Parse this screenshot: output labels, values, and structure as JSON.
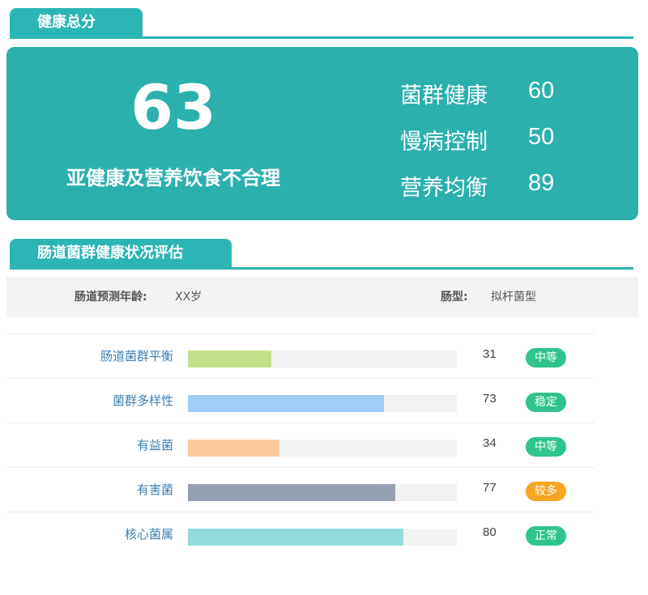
{
  "header1": {
    "title": "健康总分"
  },
  "score": {
    "total": "63",
    "verdict": "亚健康及营养饮食不合理",
    "subs": [
      {
        "label": "菌群健康",
        "value": "60"
      },
      {
        "label": "慢病控制",
        "value": "50"
      },
      {
        "label": "营养均衡",
        "value": "89"
      }
    ]
  },
  "header2": {
    "title": "肠道菌群健康状况评估"
  },
  "info": {
    "age_label": "肠道预测年龄:",
    "age_value": "XX岁",
    "type_label": "肠型:",
    "type_value": "拟杆菌型"
  },
  "metrics": [
    {
      "label": "肠道菌群平衡",
      "value": 31,
      "badge": "中等",
      "bar_color": "#c5e08a",
      "badge_color": "#2fc48d"
    },
    {
      "label": "菌群多样性",
      "value": 73,
      "badge": "稳定",
      "bar_color": "#9fcdf8",
      "badge_color": "#2fc48d"
    },
    {
      "label": "有益菌",
      "value": 34,
      "badge": "中等",
      "bar_color": "#fccb9c",
      "badge_color": "#2fc48d"
    },
    {
      "label": "有害菌",
      "value": 77,
      "badge": "较多",
      "bar_color": "#95a0b3",
      "badge_color": "#f5a623"
    },
    {
      "label": "核心菌属",
      "value": 80,
      "badge": "正常",
      "bar_color": "#94dbdd",
      "badge_color": "#2fc48d"
    }
  ],
  "colors": {
    "accent": "#2bb0ae"
  }
}
